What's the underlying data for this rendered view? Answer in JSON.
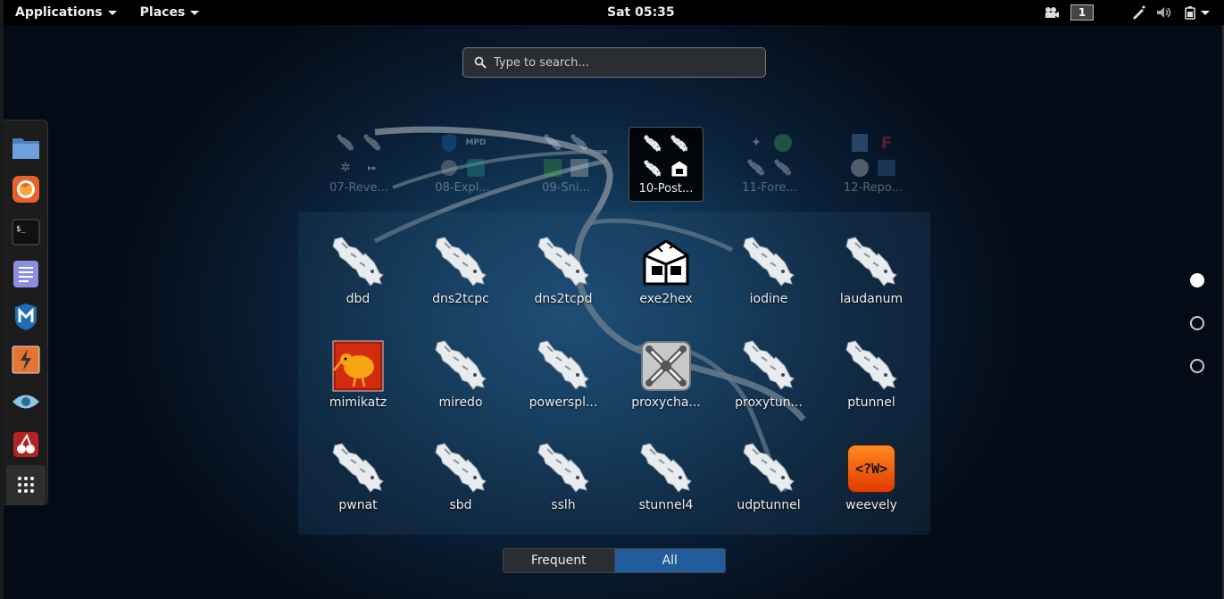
{
  "topbar": {
    "applications_label": "Applications",
    "places_label": "Places",
    "clock": "Sat 05:35",
    "workspace_number": "1"
  },
  "search": {
    "placeholder": "Type to search..."
  },
  "dash": {
    "items": [
      {
        "name": "files",
        "icon": "folder-icon"
      },
      {
        "name": "firefox",
        "icon": "firefox-icon"
      },
      {
        "name": "terminal",
        "icon": "terminal-icon"
      },
      {
        "name": "text-editor",
        "icon": "text-editor-icon"
      },
      {
        "name": "metasploit",
        "icon": "metasploit-icon"
      },
      {
        "name": "burpsuite",
        "icon": "burpsuite-icon"
      },
      {
        "name": "maltego",
        "icon": "eye-icon"
      },
      {
        "name": "cherrytree",
        "icon": "cherry-icon"
      },
      {
        "name": "show-applications",
        "icon": "app-grid-icon"
      }
    ]
  },
  "folders": [
    {
      "label": "07-Reve...",
      "state": "dim"
    },
    {
      "label": "08-Expl...",
      "state": "dim"
    },
    {
      "label": "09-Sni...",
      "state": "dim"
    },
    {
      "label": "10-Post...",
      "state": "active"
    },
    {
      "label": "11-Fore...",
      "state": "dim"
    },
    {
      "label": "12-Repo...",
      "state": "dim"
    }
  ],
  "apps": [
    {
      "label": "dbd",
      "icon": "kali-dragon-icon"
    },
    {
      "label": "dns2tcpc",
      "icon": "kali-dragon-icon"
    },
    {
      "label": "dns2tcpd",
      "icon": "kali-dragon-icon"
    },
    {
      "label": "exe2hex",
      "icon": "exe2hex-icon"
    },
    {
      "label": "iodine",
      "icon": "kali-dragon-icon"
    },
    {
      "label": "laudanum",
      "icon": "kali-dragon-icon"
    },
    {
      "label": "mimikatz",
      "icon": "mimikatz-kiwi-icon"
    },
    {
      "label": "miredo",
      "icon": "kali-dragon-icon"
    },
    {
      "label": "powerspl...",
      "icon": "kali-dragon-icon"
    },
    {
      "label": "proxycha...",
      "icon": "proxychains-icon"
    },
    {
      "label": "proxytun...",
      "icon": "kali-dragon-icon"
    },
    {
      "label": "ptunnel",
      "icon": "kali-dragon-icon"
    },
    {
      "label": "pwnat",
      "icon": "kali-dragon-icon"
    },
    {
      "label": "sbd",
      "icon": "kali-dragon-icon"
    },
    {
      "label": "sslh",
      "icon": "kali-dragon-icon"
    },
    {
      "label": "stunnel4",
      "icon": "kali-dragon-icon"
    },
    {
      "label": "udptunnel",
      "icon": "kali-dragon-icon"
    },
    {
      "label": "weevely",
      "icon": "weevely-icon"
    }
  ],
  "weevely_icon_text": "<?W>",
  "view_toggle": {
    "frequent_label": "Frequent",
    "all_label": "All",
    "selected": "All"
  },
  "page_indicator": {
    "pages": 3,
    "current": 1
  },
  "colors": {
    "accent": "#215d9c",
    "topbar": "#000000"
  }
}
